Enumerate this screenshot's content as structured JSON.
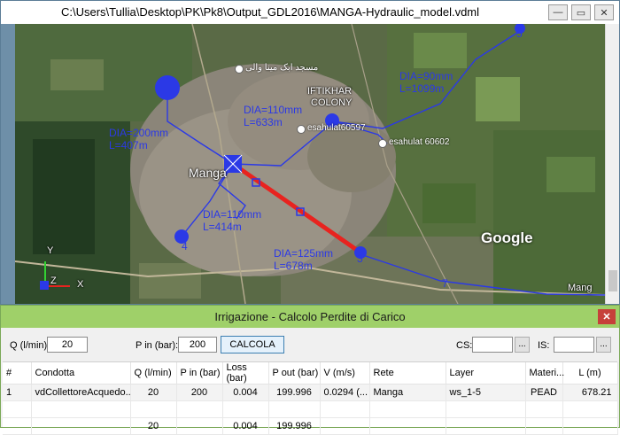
{
  "map_window": {
    "title": "C:\\Users\\Tullia\\Desktop\\PK\\Pk8\\Output_GDL2016\\MANGA-Hydraulic_model.vdml",
    "buttons": {
      "minimize": "—",
      "restore": "▭",
      "close": "✕"
    },
    "pipe_labels": [
      {
        "dia": "DIA=90mm",
        "len": "L=1099m"
      },
      {
        "dia": "DIA=110mm",
        "len": "L=633m"
      },
      {
        "dia": "DIA=200mm",
        "len": "L=407m"
      },
      {
        "dia": "DIA=110mm",
        "len": "L=414m"
      },
      {
        "dia": "DIA=125mm",
        "len": "L=678m"
      }
    ],
    "node_ids": [
      "5",
      "4",
      "7",
      "3"
    ],
    "places": {
      "iftikhar": "IFTIKHAR",
      "colony": "COLONY",
      "manga": "Manga",
      "manga_right": "Mang",
      "mosque": "مسجد ابک مینا والی",
      "esahulat1": "esahulat60597",
      "esahulat2": "esahulat 60602"
    },
    "google_logo": "Google",
    "axis": {
      "y": "Y",
      "z": "Z",
      "x": "X"
    }
  },
  "calc_window": {
    "title": "Irrigazione - Calcolo Perdite di Carico",
    "close": "✕",
    "q_label": "Q (l/min):",
    "q_value": "20",
    "p_label": "P in (bar):",
    "p_value": "200",
    "calc_button": "CALCOLA",
    "cs_label": "CS:",
    "is_label": "IS:",
    "dots": "...",
    "columns": [
      "#",
      "Condotta",
      "Q (l/min)",
      "P in (bar)",
      "Loss (bar)",
      "P out (bar)",
      "V (m/s)",
      "Rete",
      "Layer",
      "Materi...",
      "L (m)"
    ],
    "rows": [
      {
        "n": "1",
        "condotta": "vdCollettoreAcquedo...",
        "q": "20",
        "pin": "200",
        "loss": "0.004",
        "pout": "199.996",
        "v": "0.0294 (...",
        "rete": "Manga",
        "layer": "ws_1-5",
        "mat": "PEAD",
        "l": "678.21"
      },
      {
        "n": "",
        "condotta": "",
        "q": "",
        "pin": "",
        "loss": "",
        "pout": "",
        "v": "",
        "rete": "",
        "layer": "",
        "mat": "",
        "l": ""
      },
      {
        "n": "",
        "condotta": "",
        "q": "20",
        "pin": "",
        "loss": "0.004",
        "pout": "199.996",
        "v": "",
        "rete": "",
        "layer": "",
        "mat": "",
        "l": ""
      }
    ]
  },
  "colors": {
    "pipe": "#2b39e6",
    "selected_pipe": "#e8231f",
    "title_green": "#9fd069"
  }
}
